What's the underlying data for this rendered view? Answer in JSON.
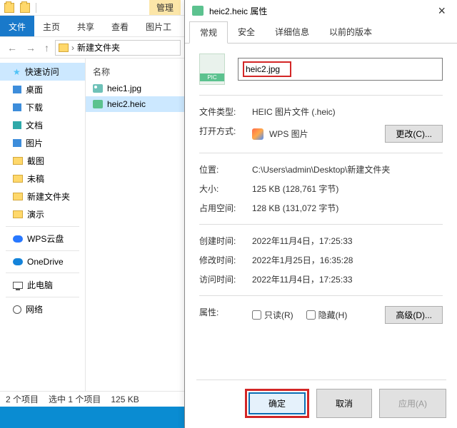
{
  "explorer": {
    "manage": "管理",
    "ribbon": {
      "file": "文件",
      "home": "主页",
      "share": "共享",
      "view": "查看",
      "pictools": "图片工"
    },
    "breadcrumb": "新建文件夹",
    "sidebar": {
      "quick": "快速访问",
      "desktop": "桌面",
      "downloads": "下载",
      "documents": "文档",
      "pictures": "图片",
      "screenshots": "截图",
      "drafts": "未稿",
      "newfolder": "新建文件夹",
      "demo": "演示",
      "wpscloud": "WPS云盘",
      "onedrive": "OneDrive",
      "thispc": "此电脑",
      "network": "网络"
    },
    "filelist": {
      "header": "名称",
      "items": [
        "heic1.jpg",
        "heic2.heic"
      ]
    },
    "status": {
      "count": "2 个项目",
      "selected": "选中 1 个项目",
      "size": "125 KB"
    }
  },
  "props": {
    "title": "heic2.heic 属性",
    "tabs": {
      "general": "常规",
      "security": "安全",
      "details": "详细信息",
      "previous": "以前的版本"
    },
    "filename": "heic2.jpg",
    "rows": {
      "type_k": "文件类型:",
      "type_v": "HEIC 图片文件 (.heic)",
      "open_k": "打开方式:",
      "open_v": "WPS 图片",
      "change": "更改(C)...",
      "loc_k": "位置:",
      "loc_v": "C:\\Users\\admin\\Desktop\\新建文件夹",
      "size_k": "大小:",
      "size_v": "125 KB (128,761 字节)",
      "disk_k": "占用空间:",
      "disk_v": "128 KB (131,072 字节)",
      "created_k": "创建时间:",
      "created_v": "2022年11月4日，17:25:33",
      "modified_k": "修改时间:",
      "modified_v": "2022年1月25日，16:35:28",
      "accessed_k": "访问时间:",
      "accessed_v": "2022年11月4日，17:25:33",
      "attr_k": "属性:",
      "readonly": "只读(R)",
      "hidden": "隐藏(H)",
      "advanced": "高级(D)..."
    },
    "buttons": {
      "ok": "确定",
      "cancel": "取消",
      "apply": "应用(A)"
    }
  }
}
